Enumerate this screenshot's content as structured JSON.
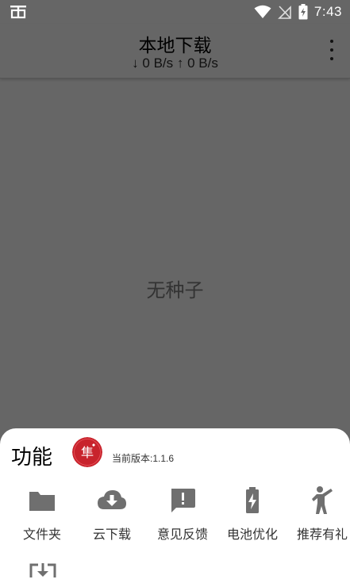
{
  "status_bar": {
    "time": "7:43",
    "icons": [
      "app-notification-icon",
      "wifi-icon",
      "no-signal-icon",
      "battery-charging-icon"
    ]
  },
  "app_bar": {
    "title": "本地下载",
    "speed": "↓ 0 B/s ↑ 0 B/s",
    "menu_icon": "more-vert-icon"
  },
  "main": {
    "empty_text": "无种子"
  },
  "sheet": {
    "title": "功能",
    "version": "当前版本:1.1.6",
    "logo_glyph": "隼",
    "items": [
      {
        "label": "文件夹",
        "icon": "folder-icon"
      },
      {
        "label": "云下载",
        "icon": "cloud-download-icon"
      },
      {
        "label": "意见反馈",
        "icon": "feedback-icon"
      },
      {
        "label": "电池优化",
        "icon": "battery-charging-icon"
      },
      {
        "label": "推荐有礼",
        "icon": "person-icon"
      }
    ],
    "partial_icon": "download-box-icon"
  },
  "colors": {
    "overlay": "#666666",
    "sheet_bg": "#ffffff",
    "icon_gray": "#6f6f6f",
    "logo_red": "#c8232c"
  }
}
